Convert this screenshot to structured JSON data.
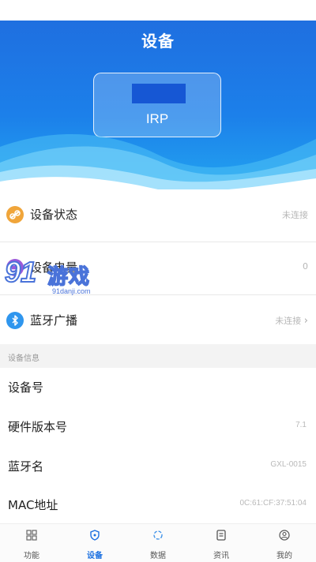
{
  "header": {
    "title": "设备"
  },
  "device": {
    "name": "IRP"
  },
  "status_rows": [
    {
      "label": "设备状态",
      "value": "未连接",
      "icon": "link-icon",
      "icon_color": "#f0a53a"
    },
    {
      "label": "设备电量",
      "value": "0",
      "icon": "battery-icon",
      "icon_color": "#9b59d9"
    },
    {
      "label": "蓝牙广播",
      "value": "未连接",
      "icon": "bluetooth-icon",
      "icon_color": "#2f96ee"
    }
  ],
  "device_info": {
    "section_title": "设备信息",
    "rows": [
      {
        "label": "设备号",
        "value": ""
      },
      {
        "label": "硬件版本号",
        "value": "7.1"
      },
      {
        "label": "蓝牙名",
        "value": "GXL-0015"
      },
      {
        "label": "MAC地址",
        "value": "0C:61:CF:37:51:04"
      }
    ]
  },
  "tabs": [
    {
      "label": "功能",
      "icon": "grid-icon"
    },
    {
      "label": "设备",
      "icon": "shield-icon",
      "active": true
    },
    {
      "label": "数据",
      "icon": "refresh-icon"
    },
    {
      "label": "资讯",
      "icon": "news-icon"
    },
    {
      "label": "我的",
      "icon": "user-icon"
    }
  ],
  "watermark": {
    "number": "91",
    "text": "游戏",
    "url": "91danji.com"
  },
  "colors": {
    "accent": "#1a6fe0",
    "header_top": "#1f6fe0",
    "header_bottom": "#23a6f0"
  }
}
